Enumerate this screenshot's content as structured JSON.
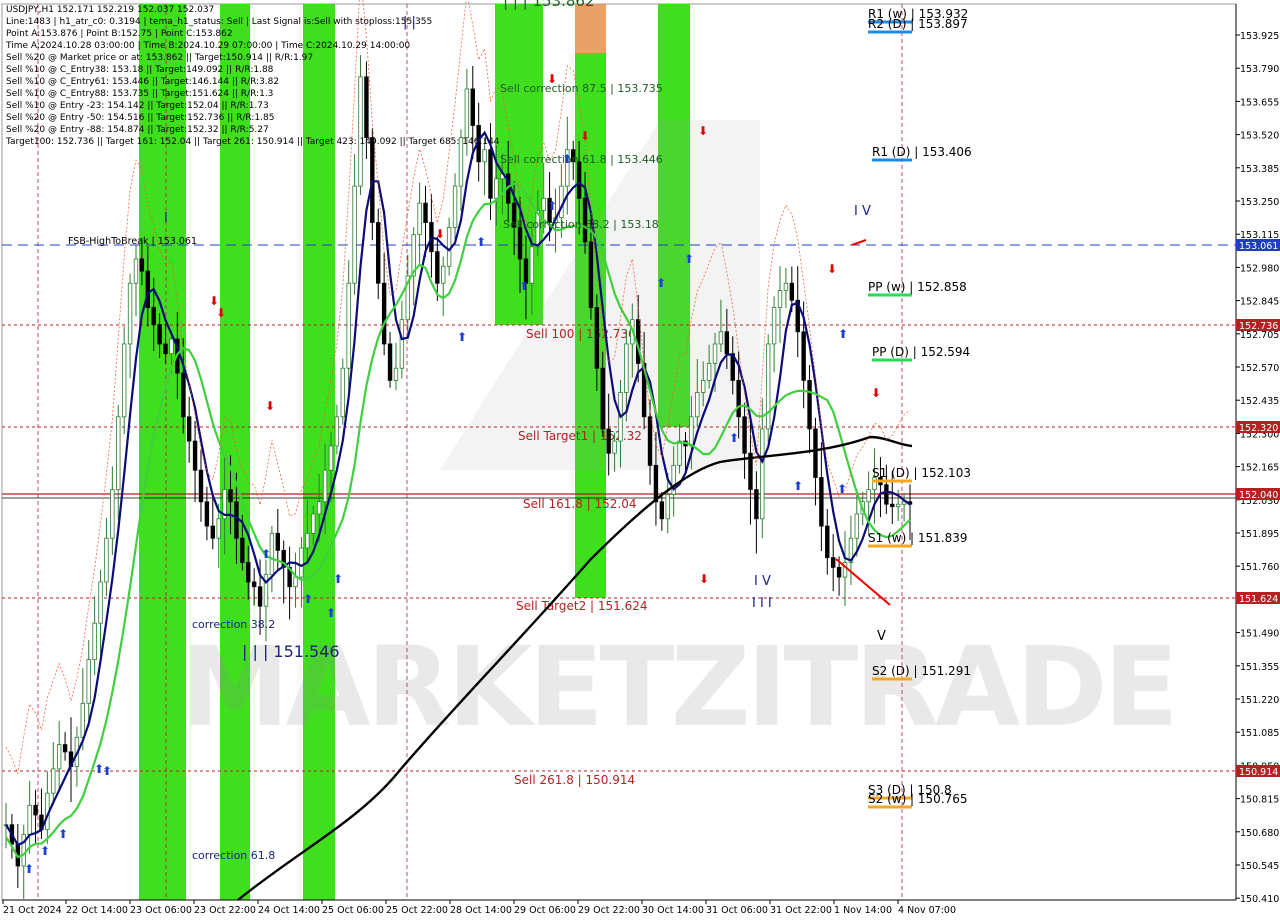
{
  "info_panel": [
    "USDJPY,H1  152.171 152.219 152.037 152.037",
    "Line:1483 | h1_atr_c0: 0.3194 | tema_h1_status: Sell | Last Signal is:Sell with stoploss:155.355",
    "Point A:153.876 | Point B:152.75 | Point C:153.862",
    "Time A:2024.10.28 03:00:00 | Time B:2024.10.29 07:00:00 | Time C:2024.10.29 14:00:00",
    "Sell %20 @ Market price or at: 153.862 || Target:150.914 || R/R:1.97",
    "Sell %10 @ C_Entry38: 153.18 || Target:149.092 || R/R:1.88",
    "Sell %10 @ C_Entry61: 153.446 || Target:146.144 || R/R:3.82",
    "Sell %10 @ C_Entry88: 153.735 || Target:151.624 || R/R:1.3",
    "Sell %10 @ Entry -23: 154.142 || Target:152.04 || R/R:1.73",
    "Sell %20 @ Entry -50: 154.516 || Target:152.736 || R/R:1.85",
    "Sell %20 @ Entry -88: 154.874 || Target:152.32 || R/R:5.27",
    "Target100: 152.736 || Target 161: 152.04 || Target 261: 150.914 || Target 423: 149.092 || Target 685: 146.144"
  ],
  "watermark": "MARKETZITRADE",
  "colors": {
    "up_candle": "#2e7d32",
    "down_candle": "#000000",
    "green_zone": "#35dd12",
    "orange_zone": "#e8914a",
    "blue_ma": "#0b0b7a",
    "green_ma": "#3fcf3f",
    "black_ma": "#000000",
    "red_level": "#b22222",
    "fsb_line": "#1f3fbf"
  },
  "chart_data": {
    "type": "candlestick",
    "symbol": "USDJPY",
    "timeframe": "H1",
    "ylim": [
      150.41,
      154.1
    ],
    "y_ticks": [
      "153.970",
      "153.640",
      "153.310",
      "152.970",
      "152.640",
      "152.305",
      "151.970",
      "151.630",
      "151.290",
      "150.950",
      "150.615",
      "150.280"
    ],
    "y_ticks_raw": [
      "153.925",
      "153.790",
      "153.655",
      "153.520",
      "153.385",
      "153.250",
      "153.115",
      "152.980",
      "152.845",
      "152.705",
      "152.570",
      "152.435",
      "152.300",
      "152.165",
      "152.030",
      "151.895",
      "151.760",
      "151.625",
      "151.490",
      "151.355",
      "151.220",
      "151.085",
      "150.950",
      "150.815",
      "150.680",
      "150.545",
      "150.410"
    ],
    "x_ticks": [
      "21 Oct 2024",
      "22 Oct 14:00",
      "23 Oct 06:00",
      "23 Oct 22:00",
      "24 Oct 14:00",
      "25 Oct 06:00",
      "25 Oct 22:00",
      "28 Oct 14:00",
      "29 Oct 06:00",
      "29 Oct 22:00",
      "30 Oct 14:00",
      "31 Oct 06:00",
      "31 Oct 22:00",
      "1 Nov 14:00",
      "4 Nov 07:00"
    ],
    "price_tags": [
      {
        "label": "153.061",
        "value": 153.061,
        "color": "#1f3fbf"
      },
      {
        "label": "152.736",
        "value": 152.736,
        "color": "#b22222"
      },
      {
        "label": "152.320",
        "value": 152.32,
        "color": "#b22222"
      },
      {
        "label": "152.040",
        "value": 152.04,
        "color": "#b22222"
      },
      {
        "label": "151.624",
        "value": 151.624,
        "color": "#b22222"
      },
      {
        "label": "150.914",
        "value": 150.914,
        "color": "#b22222"
      }
    ],
    "horizontal_lines": [
      {
        "label": "FSB-HighToBreak | 153.061",
        "value": 153.061,
        "style": "dashed",
        "color": "#1f3fbf"
      },
      {
        "label": "Sell 100 | 152.736",
        "value": 152.736,
        "style": "dotted",
        "color": "#b22222"
      },
      {
        "label": "Sell Target1 | 152.32",
        "value": 152.32,
        "style": "dotted",
        "color": "#b22222"
      },
      {
        "label": "Sell 161.8 | 152.04",
        "value": 152.04,
        "style": "solid",
        "color": "#b22222"
      },
      {
        "label": "Sell Target2 | 151.624",
        "value": 151.624,
        "style": "dotted",
        "color": "#b22222"
      },
      {
        "label": "Sell 261.8 | 150.914",
        "value": 150.914,
        "style": "dotted",
        "color": "#b22222"
      }
    ],
    "annotations": [
      {
        "text": "Sell correction 87.5 | 153.735",
        "value": 153.735
      },
      {
        "text": "Sell correction 61.8 | 153.446",
        "value": 153.446
      },
      {
        "text": "Sell correction 38.2 | 153.18",
        "value": 153.18
      },
      {
        "text": "correction 38.2",
        "value": 151.55
      },
      {
        "text": "correction 61.8",
        "value": 150.64
      },
      {
        "text": "| | | 151.546",
        "value": 151.546
      },
      {
        "text": "| | | 153.862",
        "value": 154.1
      }
    ],
    "pivots": [
      {
        "label": "R1 (w) | 153.932",
        "value": 153.932,
        "color": "#1e8be0"
      },
      {
        "label": "R2 (D) | 153.897",
        "value": 153.897,
        "color": "#1e8be0"
      },
      {
        "label": "R1 (D) | 153.406",
        "value": 153.406,
        "color": "#1e8be0"
      },
      {
        "label": "PP (w) | 152.858",
        "value": 152.858,
        "color": "#22dd55"
      },
      {
        "label": "PP (D) | 152.594",
        "value": 152.594,
        "color": "#22dd55"
      },
      {
        "label": "S1 (D) | 152.103",
        "value": 152.103,
        "color": "#f5a623"
      },
      {
        "label": "S1 (w) | 151.839",
        "value": 151.839,
        "color": "#f5a623"
      },
      {
        "label": "S2 (D) | 151.291",
        "value": 151.291,
        "color": "#f5a623"
      },
      {
        "label": "S3 (D) | 150.8",
        "value": 150.8,
        "color": "#f5a623"
      },
      {
        "label": "S2 (w) | 150.765",
        "value": 150.765,
        "color": "#f5a623"
      }
    ],
    "candle_count": 154,
    "candles_seed_path": [
      150.72,
      150.64,
      150.55,
      150.68,
      150.8,
      150.76,
      150.7,
      150.85,
      150.95,
      151.05,
      151.02,
      150.96,
      151.08,
      151.22,
      151.4,
      151.55,
      151.72,
      151.9,
      152.1,
      152.4,
      152.7,
      152.95,
      153.05,
      153.0,
      152.85,
      152.78,
      152.7,
      152.66,
      152.72,
      152.58,
      152.4,
      152.3,
      152.18,
      152.05,
      151.95,
      151.9,
      151.98,
      152.1,
      152.05,
      151.9,
      151.8,
      151.72,
      151.7,
      151.62,
      151.75,
      151.92,
      151.85,
      151.78,
      151.7,
      151.74,
      151.86,
      151.92,
      152.0,
      152.05,
      152.18,
      152.28,
      152.4,
      152.6,
      152.95,
      153.35,
      153.8,
      153.55,
      153.2,
      152.95,
      152.7,
      152.55,
      152.6,
      152.8,
      152.98,
      153.15,
      153.28,
      153.2,
      153.08,
      152.95,
      153.02,
      153.18,
      153.35,
      153.55,
      153.75,
      153.6,
      153.45,
      153.5,
      153.3,
      153.38,
      153.4,
      153.28,
      153.18,
      153.05,
      152.95,
      153.1,
      153.25,
      153.3,
      153.2,
      153.22,
      153.35,
      153.5,
      153.45,
      153.3,
      153.12,
      152.85,
      152.6,
      152.35,
      152.25,
      152.3,
      152.5,
      152.7,
      152.8,
      152.62,
      152.4,
      152.2,
      152.05,
      151.98,
      152.08,
      152.2,
      152.3,
      152.28,
      152.4,
      152.5,
      152.55,
      152.62,
      152.7,
      152.75,
      152.66,
      152.55,
      152.4,
      152.25,
      152.1,
      151.98,
      152.35,
      152.7,
      152.85,
      152.92,
      152.95,
      152.88,
      152.75,
      152.55,
      152.35,
      152.15,
      151.95,
      151.82,
      151.78,
      151.74,
      151.8,
      151.9,
      152.0,
      152.05,
      152.1,
      152.15,
      152.12,
      152.04,
      152.03,
      152.04,
      152.05,
      152.04
    ]
  }
}
